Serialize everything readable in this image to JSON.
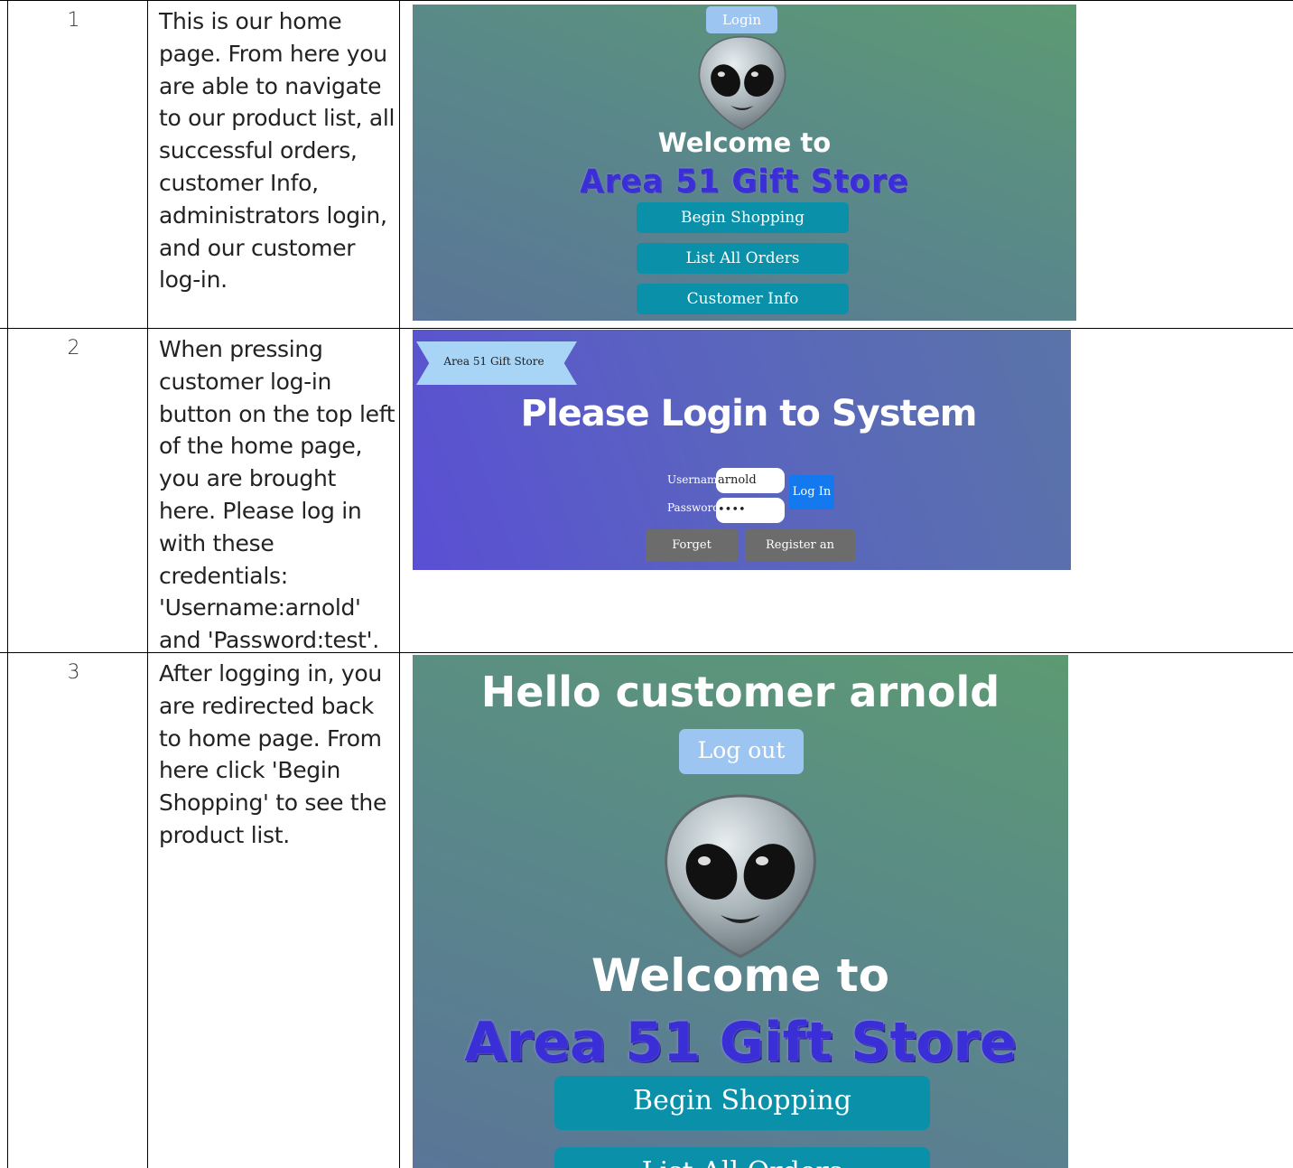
{
  "rows": [
    {
      "number": "1",
      "description": "This is our home page. From here you are able to navigate to our product list, all successful orders, customer Info, administrators login, and our customer log-in."
    },
    {
      "number": "2",
      "description": "When pressing customer log-in button on the top left of the home page, you are brought here. Please log in with these credentials: 'Username:arnold' and 'Password:test'."
    },
    {
      "number": "3",
      "description": "After logging in, you are redirected back to home page. From here click 'Begin Shopping' to see the product list."
    }
  ],
  "home": {
    "login_label": "Login",
    "welcome": "Welcome to",
    "store_name": "Area 51 Gift Store",
    "buttons": [
      "Begin Shopping",
      "List All Orders",
      "Customer Info"
    ]
  },
  "login_page": {
    "ribbon_text": "Area 51 Gift Store",
    "title": "Please Login to System",
    "username_label": "Username:",
    "username_value": "arnold",
    "password_label": "Password:",
    "password_value": "••••",
    "login_button": "Log In",
    "forget_button": "Forget password",
    "register_button": "Register an account"
  },
  "logged_in": {
    "hello": "Hello customer arnold",
    "logout_label": "Log out",
    "welcome": "Welcome to",
    "store_name": "Area 51 Gift Store",
    "buttons": [
      "Begin Shopping",
      "List All Orders"
    ]
  },
  "colors": {
    "teal_button": "#0a90a8",
    "light_blue_button": "#9dc5f2",
    "store_name_blue": "#3a2fd6",
    "login_blue": "#1479ee"
  },
  "icons": [
    "alien-icon"
  ]
}
